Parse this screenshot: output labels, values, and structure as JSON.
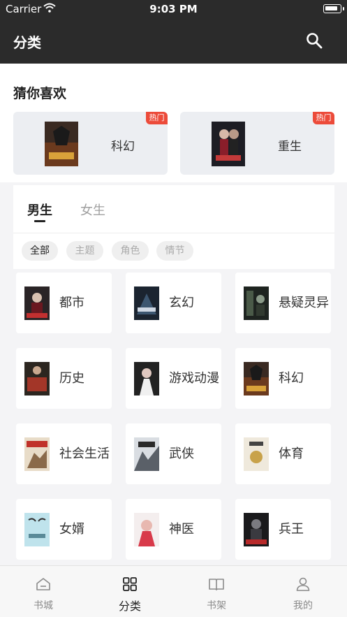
{
  "status_bar": {
    "carrier": "Carrier",
    "time": "9:03 PM"
  },
  "nav": {
    "title": "分类",
    "search_icon": "search-icon"
  },
  "guess": {
    "title": "猜你喜欢",
    "items": [
      {
        "label": "科幻",
        "badge": "热门"
      },
      {
        "label": "重生",
        "badge": "热门"
      }
    ]
  },
  "tabs": {
    "male": "男生",
    "female": "女生",
    "active": "男生"
  },
  "filters": [
    "全部",
    "主题",
    "角色",
    "情节"
  ],
  "categories": [
    "都市",
    "玄幻",
    "悬疑灵异",
    "历史",
    "游戏动漫",
    "科幻",
    "社会生活",
    "武侠",
    "体育",
    "女婿",
    "神医",
    "兵王"
  ],
  "tabbar": [
    "书城",
    "分类",
    "书架",
    "我的"
  ],
  "colors": {
    "bar": "#2b2b2b",
    "hot": "#ec4b3a",
    "bg": "#f4f4f6"
  }
}
